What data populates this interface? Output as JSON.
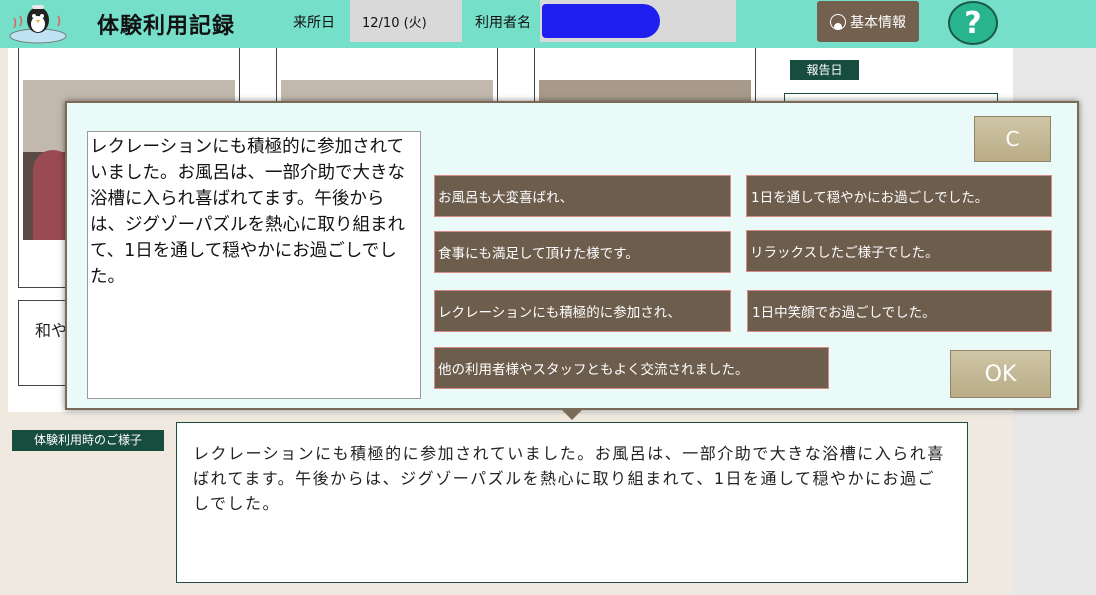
{
  "header": {
    "title": "体験利用記録",
    "visit_label": "来所日",
    "visit_value": "12/10 (火)",
    "user_label": "利用者名",
    "basic_info_label": "基本情報",
    "help_label": "?"
  },
  "colors": {
    "header_bg": "#76dfc9",
    "label_bg": "#174d3e",
    "phrase_button_bg": "#6d5d4c",
    "action_button_bg": "#c4b994"
  },
  "background": {
    "left_note_text": "和や まれ",
    "report_label": "報告日"
  },
  "popup": {
    "text": "レクレーションにも積極的に参加されていました。お風呂は、一部介助で大きな浴槽に入られ喜ばれてます。午後からは、ジグゾーパズルを熱心に取り組まれて、1日を通して穏やかにお過ごしでした。",
    "clear_label": "C",
    "ok_label": "OK",
    "phrases": [
      "お風呂も大変喜ばれ、",
      "1日を通して穏やかにお過ごしでした。",
      "食事にも満足して頂けた様です。",
      "リラックスしたご様子でした。",
      "レクレーションにも積極的に参加され、",
      "1日中笑顔でお過ごしでした。",
      "他の利用者様やスタッフともよく交流されました。"
    ]
  },
  "status": {
    "label": "体験利用時のご様子",
    "text": "レクレーションにも積極的に参加されていました。お風呂は、一部介助で大きな浴槽に入られ喜ばれてます。午後からは、ジグゾーパズルを熱心に取り組まれて、1日を通して穏やかにお過ごしでした。"
  }
}
